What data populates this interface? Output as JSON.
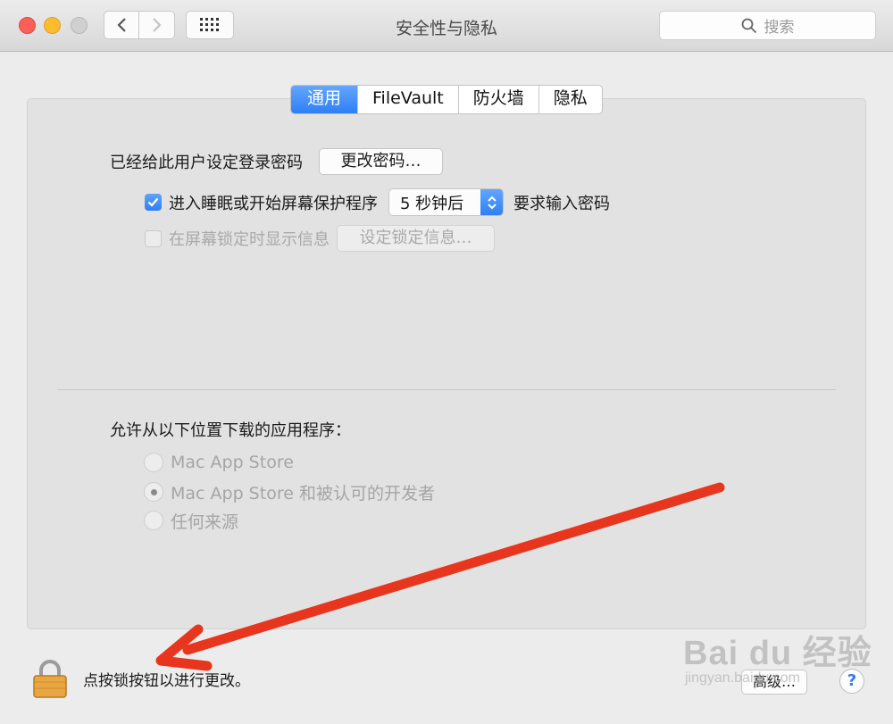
{
  "window": {
    "title": "安全性与隐私"
  },
  "toolbar": {
    "search_placeholder": "搜索"
  },
  "tabs": [
    {
      "label": "通用",
      "active": true
    },
    {
      "label": "FileVault",
      "active": false
    },
    {
      "label": "防火墙",
      "active": false
    },
    {
      "label": "隐私",
      "active": false
    }
  ],
  "general": {
    "password_set_label": "已经给此用户设定登录密码",
    "change_password_button": "更改密码…",
    "require_password_checkbox": {
      "label": "进入睡眠或开始屏幕保护程序",
      "checked": true
    },
    "require_password_delay": "5 秒钟后",
    "require_password_suffix": "要求输入密码",
    "lock_message_checkbox": {
      "label": "在屏幕锁定时显示信息",
      "checked": false,
      "enabled": false
    },
    "set_lock_message_button": "设定锁定信息…",
    "download_heading": "允许从以下位置下载的应用程序：",
    "download_options": [
      {
        "label": "Mac App Store",
        "selected": false
      },
      {
        "label": "Mac App Store 和被认可的开发者",
        "selected": true
      },
      {
        "label": "任何来源",
        "selected": false
      }
    ]
  },
  "footer": {
    "lock_text": "点按锁按钮以进行更改。",
    "advanced_button": "高级…",
    "help_button": "?"
  },
  "watermark": {
    "brand": "Bai du 经验",
    "url": "jingyan.baidu.com"
  },
  "colors": {
    "accent": "#2f7ff5",
    "annotation_arrow": "#e8361e"
  }
}
